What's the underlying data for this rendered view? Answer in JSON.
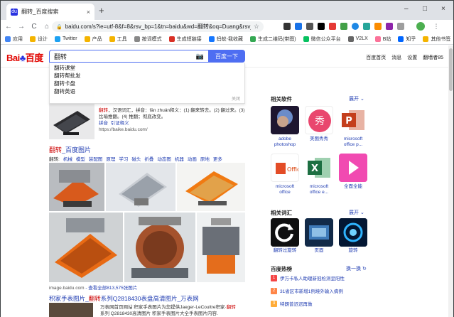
{
  "tab": {
    "title": "翻转_百度搜索",
    "close": "×",
    "favicon": "du"
  },
  "window": {
    "newtab": "+",
    "minimize": "–",
    "maximize": "□",
    "close": "×"
  },
  "toolbar": {
    "back": "←",
    "forward": "→",
    "reload": "C",
    "home": "⌂",
    "url": "baidu.com/s?ie=utf-8&f=8&rsv_bp=1&tn=baidu&wd=翻转&oq=Duang&rsv_...",
    "star": "☆"
  },
  "bookmarks": [
    {
      "label": "应用",
      "color": "#4285f4"
    },
    {
      "label": "设计",
      "color": "#f4b400"
    },
    {
      "label": "Twitter",
      "color": "#1da1f2"
    },
    {
      "label": "产品",
      "color": "#f4b400"
    },
    {
      "label": "工具",
      "color": "#f4b400"
    },
    {
      "label": "按词模式",
      "color": "#888888"
    },
    {
      "label": "生成短链接",
      "color": "#d93025"
    },
    {
      "label": "蚂蚁-我收藏",
      "color": "#1677ff"
    },
    {
      "label": "生成二维码(带图)",
      "color": "#34a853"
    },
    {
      "label": "微信公众平台",
      "color": "#07c160"
    },
    {
      "label": "V2LX",
      "color": "#666666"
    },
    {
      "label": "B站",
      "color": "#fb7299"
    },
    {
      "label": "知乎",
      "color": "#0066ff"
    },
    {
      "label": "其他书签",
      "color": "#f4b400"
    }
  ],
  "search": {
    "query": "翻转",
    "button": "百度一下"
  },
  "suggestions": [
    "翻转课堂",
    "翻转帮批发",
    "翻转卡盘",
    "翻转英语"
  ],
  "suggest_close": "关闭",
  "toplinks": [
    "百度首页",
    "消息",
    "设置",
    "翻墙者85"
  ],
  "result1": {
    "hl": "翻转",
    "text": "，汉语词汇，拼音：fān zhuǎn释义：(1) 翻来转去。(2) 翻过来。(3) 比喻推翻。(4) 推翻；彻底改变。",
    "links": [
      "拼音",
      "引证释义"
    ],
    "source": "https://baike.baidu.com/"
  },
  "images": {
    "title_hl": "翻转",
    "title": "_百度图片",
    "tag_label": "翻转:",
    "tags": [
      "机械",
      "模型",
      "装配图",
      "原理",
      "学习",
      "磁头",
      "折叠",
      "动态图",
      "机器",
      "动画",
      "原地",
      "更多"
    ],
    "source": "image.baidu.com",
    "more": "- 查看全部813,575张图片"
  },
  "result3": {
    "title_pre": "积家手表图片_",
    "title_hl": "翻转",
    "title_post": "系列Q2818430表盘高清图片_万表网",
    "desc1": "万表网首页网站 积家手表图片为您提供Jaeger-LeCoultre积家·",
    "desc1_hl": "翻转",
    "desc2": "系列 Q2818430高清图片 积家手表图片大全手表图片内容."
  },
  "right": {
    "software_title": "相关软件",
    "more": "展开",
    "software": [
      {
        "label1": "adobe",
        "label2": "photoshop",
        "color": "#2a1b3d"
      },
      {
        "label1": "美图秀秀",
        "label2": "",
        "color": "#ffffff"
      },
      {
        "label1": "microsoft",
        "label2": "office p...",
        "color": "#ffffff"
      },
      {
        "label1": "microsoft",
        "label2": "office",
        "color": "#ffffff"
      },
      {
        "label1": "microsoft",
        "label2": "office e...",
        "color": "#ffffff"
      },
      {
        "label1": "全面全能",
        "label2": "",
        "color": "#ff4db8"
      }
    ],
    "vocab_title": "相关词汇",
    "vocab": [
      {
        "label": "翻转过旋转"
      },
      {
        "label": "页面"
      },
      {
        "label": "旋转"
      }
    ],
    "hot_title": "百度热榜",
    "hot_more": "换一换",
    "hot": [
      {
        "n": "1",
        "text": "伊万卡私人助理新冠检测呈阳性",
        "color": "#f54545"
      },
      {
        "n": "2",
        "text": "31省区市新增1例境外输入病例",
        "color": "#ff8547"
      },
      {
        "n": "3",
        "text": "特朗普迟迟再做",
        "color": "#ffac38"
      }
    ]
  }
}
